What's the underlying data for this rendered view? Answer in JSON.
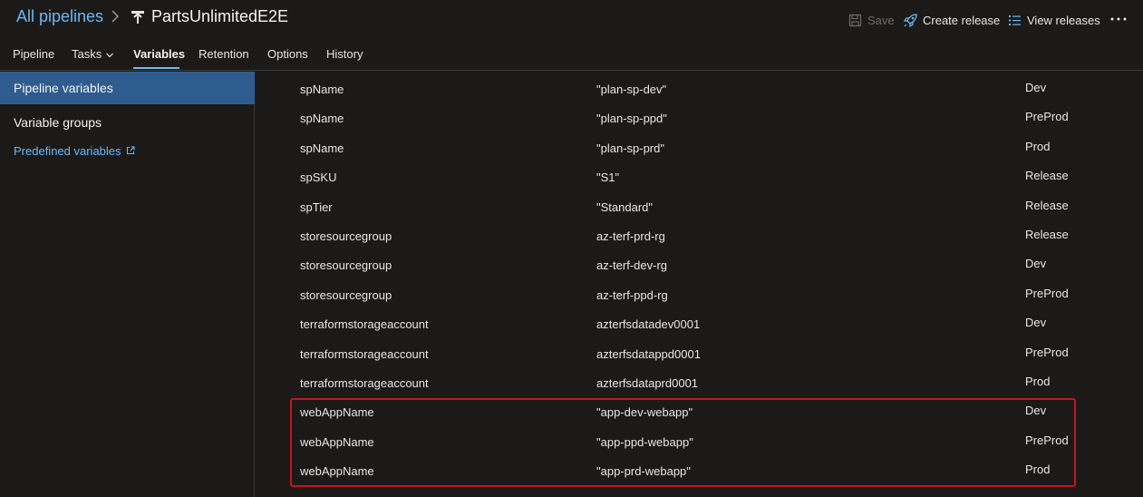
{
  "header": {
    "breadcrumb_root": "All pipelines",
    "pipeline_name": "PartsUnlimitedE2E",
    "save_label": "Save",
    "create_release_label": "Create release",
    "view_releases_label": "View releases"
  },
  "tabs": [
    {
      "label": "Pipeline"
    },
    {
      "label": "Tasks"
    },
    {
      "label": "Variables"
    },
    {
      "label": "Retention"
    },
    {
      "label": "Options"
    },
    {
      "label": "History"
    }
  ],
  "active_tab": "Variables",
  "sidebar": {
    "pipeline_variables": "Pipeline variables",
    "variable_groups": "Variable groups",
    "predefined_variables": "Predefined variables"
  },
  "variables": [
    {
      "name": "spName",
      "value": "\"plan-sp-dev\"",
      "scope": "Dev"
    },
    {
      "name": "spName",
      "value": "\"plan-sp-ppd\"",
      "scope": "PreProd"
    },
    {
      "name": "spName",
      "value": "\"plan-sp-prd\"",
      "scope": "Prod"
    },
    {
      "name": "spSKU",
      "value": "\"S1\"",
      "scope": "Release"
    },
    {
      "name": "spTier",
      "value": "\"Standard\"",
      "scope": "Release"
    },
    {
      "name": "storesourcegroup",
      "value": "az-terf-prd-rg",
      "scope": "Release"
    },
    {
      "name": "storesourcegroup",
      "value": "az-terf-dev-rg",
      "scope": "Dev"
    },
    {
      "name": "storesourcegroup",
      "value": "az-terf-ppd-rg",
      "scope": "PreProd"
    },
    {
      "name": "terraformstorageaccount",
      "value": "azterfsdatadev0001",
      "scope": "Dev"
    },
    {
      "name": "terraformstorageaccount",
      "value": "azterfsdatappd0001",
      "scope": "PreProd"
    },
    {
      "name": "terraformstorageaccount",
      "value": "azterfsdataprd0001",
      "scope": "Prod"
    },
    {
      "name": "webAppName",
      "value": "\"app-dev-webapp\"",
      "scope": "Dev"
    },
    {
      "name": "webAppName",
      "value": "\"app-ppd-webapp\"",
      "scope": "PreProd"
    },
    {
      "name": "webAppName",
      "value": "\"app-prd-webapp\"",
      "scope": "Prod"
    }
  ],
  "colors": {
    "background": "#1b1a19",
    "accent": "#6cb8f6",
    "selected": "#2f5c8f",
    "highlight_border": "#c5161d"
  },
  "icons": {
    "breadcrumb_separator": "chevron-right-icon",
    "pipeline": "pipeline-icon",
    "save": "save-icon",
    "create_release": "rocket-icon",
    "view_releases": "list-icon",
    "more": "more-icon",
    "external": "external-link-icon"
  }
}
